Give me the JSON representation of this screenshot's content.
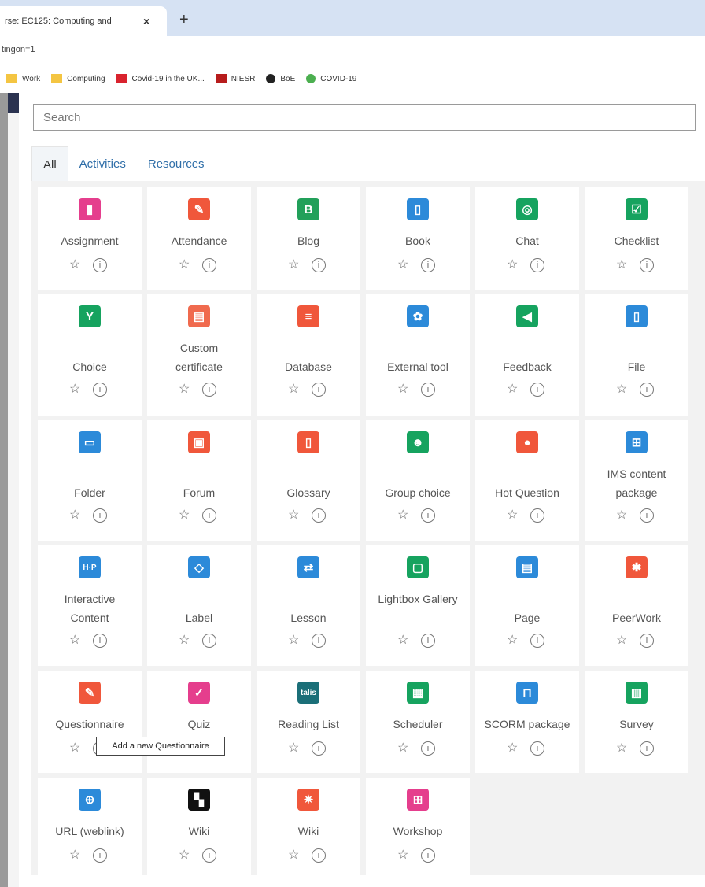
{
  "browser": {
    "tab_title": "rse: EC125: Computing and",
    "tab_close": "×",
    "new_tab": "+",
    "url": "tingon=1",
    "bookmarks": [
      {
        "label": "Work",
        "color": "#f4c542"
      },
      {
        "label": "Computing",
        "color": "#f4c542"
      },
      {
        "label": "Covid-19 in the UK...",
        "color": "#d9232e"
      },
      {
        "label": "NIESR",
        "color": "#b71c1c"
      },
      {
        "label": "BoE",
        "color": "#222222"
      },
      {
        "label": "COVID-19",
        "color": "#4caf50"
      }
    ]
  },
  "chooser": {
    "search_placeholder": "Search",
    "tabs": [
      "All",
      "Activities",
      "Resources"
    ],
    "info_glyph": "i",
    "star_glyph": "☆",
    "tooltip": "Add a new Questionnaire",
    "items": [
      {
        "label": "Assignment",
        "icon": "assignment-icon",
        "color": "#e53e8d",
        "glyph": "▮"
      },
      {
        "label": "Attendance",
        "icon": "attendance-icon",
        "color": "#f0573b",
        "glyph": "✎"
      },
      {
        "label": "Blog",
        "icon": "blog-icon",
        "color": "#22a05a",
        "glyph": "B"
      },
      {
        "label": "Book",
        "icon": "book-icon",
        "color": "#2c8ad9",
        "glyph": "▯"
      },
      {
        "label": "Chat",
        "icon": "chat-icon",
        "color": "#16a35f",
        "glyph": "◎"
      },
      {
        "label": "Checklist",
        "icon": "checklist-icon",
        "color": "#16a35f",
        "glyph": "☑"
      },
      {
        "label": "Choice",
        "icon": "choice-icon",
        "color": "#16a35f",
        "glyph": "Y"
      },
      {
        "label": "Custom certificate",
        "icon": "certificate-icon",
        "color": "#f06a4e",
        "glyph": "▤"
      },
      {
        "label": "Database",
        "icon": "database-icon",
        "color": "#f0573b",
        "glyph": "≡"
      },
      {
        "label": "External tool",
        "icon": "puzzle-icon",
        "color": "#2c8ad9",
        "glyph": "✿"
      },
      {
        "label": "Feedback",
        "icon": "megaphone-icon",
        "color": "#16a35f",
        "glyph": "◀"
      },
      {
        "label": "File",
        "icon": "file-icon",
        "color": "#2c8ad9",
        "glyph": "▯"
      },
      {
        "label": "Folder",
        "icon": "folder-icon",
        "color": "#2c8ad9",
        "glyph": "▭"
      },
      {
        "label": "Forum",
        "icon": "forum-icon",
        "color": "#f0573b",
        "glyph": "▣"
      },
      {
        "label": "Glossary",
        "icon": "glossary-icon",
        "color": "#f0573b",
        "glyph": "▯"
      },
      {
        "label": "Group choice",
        "icon": "group-icon",
        "color": "#16a35f",
        "glyph": "☻"
      },
      {
        "label": "Hot Question",
        "icon": "lightbulb-icon",
        "color": "#f0573b",
        "glyph": "●"
      },
      {
        "label": "IMS content package",
        "icon": "package-icon",
        "color": "#2c8ad9",
        "glyph": "⊞"
      },
      {
        "label": "Interactive Content",
        "icon": "h5p-icon",
        "color": "#2c8ad9",
        "glyph": "H·P"
      },
      {
        "label": "Label",
        "icon": "tag-icon",
        "color": "#2c8ad9",
        "glyph": "◇"
      },
      {
        "label": "Lesson",
        "icon": "lesson-icon",
        "color": "#2c8ad9",
        "glyph": "⇄"
      },
      {
        "label": "Lightbox Gallery",
        "icon": "gallery-icon",
        "color": "#16a35f",
        "glyph": "▢"
      },
      {
        "label": "Page",
        "icon": "page-icon",
        "color": "#2c8ad9",
        "glyph": "▤"
      },
      {
        "label": "PeerWork",
        "icon": "peerwork-icon",
        "color": "#f0573b",
        "glyph": "✱"
      },
      {
        "label": "Questionnaire",
        "icon": "questionnaire-icon",
        "color": "#f0573b",
        "glyph": "✎"
      },
      {
        "label": "Quiz",
        "icon": "quiz-icon",
        "color": "#e53e8d",
        "glyph": "✓"
      },
      {
        "label": "Reading List",
        "icon": "talis-icon",
        "color": "#1b6f78",
        "glyph": "talis"
      },
      {
        "label": "Scheduler",
        "icon": "scheduler-icon",
        "color": "#16a35f",
        "glyph": "▦"
      },
      {
        "label": "SCORM package",
        "icon": "scorm-icon",
        "color": "#2c8ad9",
        "glyph": "⊓"
      },
      {
        "label": "Survey",
        "icon": "survey-icon",
        "color": "#16a35f",
        "glyph": "▥"
      },
      {
        "label": "URL (weblink)",
        "icon": "globe-icon",
        "color": "#2c8ad9",
        "glyph": "⊕"
      },
      {
        "label": "Wiki",
        "icon": "wiki-pattern-icon",
        "color": "#111111",
        "glyph": "▚"
      },
      {
        "label": "Wiki",
        "icon": "wiki-icon",
        "color": "#f0573b",
        "glyph": "✷"
      },
      {
        "label": "Workshop",
        "icon": "workshop-icon",
        "color": "#e53e8d",
        "glyph": "⊞"
      }
    ]
  }
}
